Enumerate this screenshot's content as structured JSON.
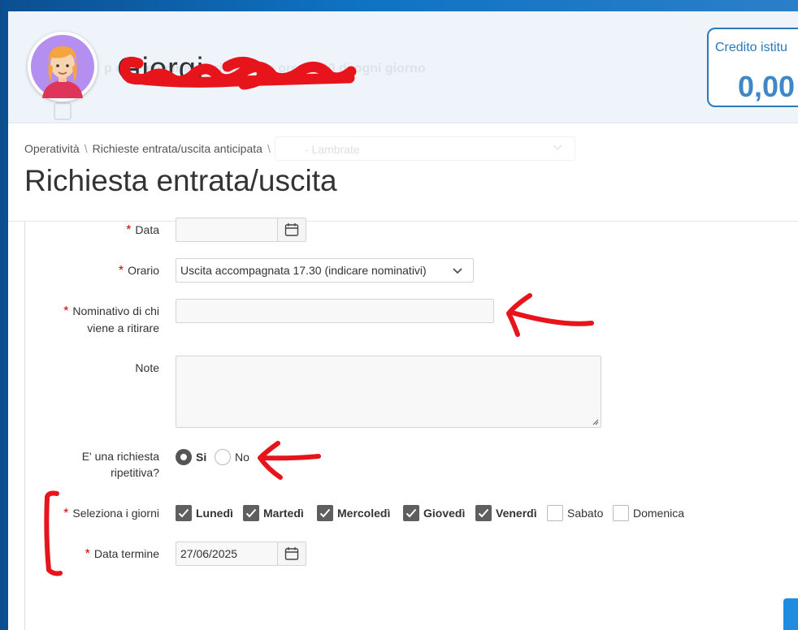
{
  "header": {
    "user_name": "Giorgi",
    "notice_background": "p ente eliminate prima delle ore 09:30 di ogni giorno",
    "credit_label": "Credito istitu",
    "credit_value": "0,00"
  },
  "breadcrumb": {
    "items": [
      "Operatività",
      "Richieste entrata/uscita anticipata"
    ],
    "separator": "\\",
    "background_select_text": "- Lambrate"
  },
  "page_title": "Richiesta entrata/uscita",
  "form": {
    "required_mark": "*",
    "data": {
      "label": "Data",
      "value": ""
    },
    "orario": {
      "label": "Orario",
      "value": "Uscita accompagnata 17.30 (indicare nominativi)"
    },
    "nominativo": {
      "label_line1": "Nominativo di chi",
      "label_line2": "viene a ritirare",
      "value": ""
    },
    "note": {
      "label": "Note",
      "value": ""
    },
    "ripetitiva": {
      "label_line1": "E' una richiesta",
      "label_line2": "ripetitiva?",
      "options": [
        {
          "label": "Si",
          "selected": true
        },
        {
          "label": "No",
          "selected": false
        }
      ]
    },
    "giorni": {
      "label": "Seleziona i giorni",
      "days": [
        {
          "label": "Lunedì",
          "checked": true
        },
        {
          "label": "Martedì",
          "checked": true
        },
        {
          "label": "Mercoledì",
          "checked": true
        },
        {
          "label": "Giovedì",
          "checked": true
        },
        {
          "label": "Venerdì",
          "checked": true
        },
        {
          "label": "Sabato",
          "checked": false
        },
        {
          "label": "Domenica",
          "checked": false
        }
      ]
    },
    "data_termine": {
      "label": "Data termine",
      "value": "27/06/2025"
    }
  },
  "colors": {
    "accent": "#2a79b8",
    "annotation": "#e8141c",
    "required": "#d40000"
  },
  "icons": {
    "calendar": "calendar-icon",
    "dropdown": "chevron-down-icon",
    "checkbox": "checkmark-icon"
  }
}
